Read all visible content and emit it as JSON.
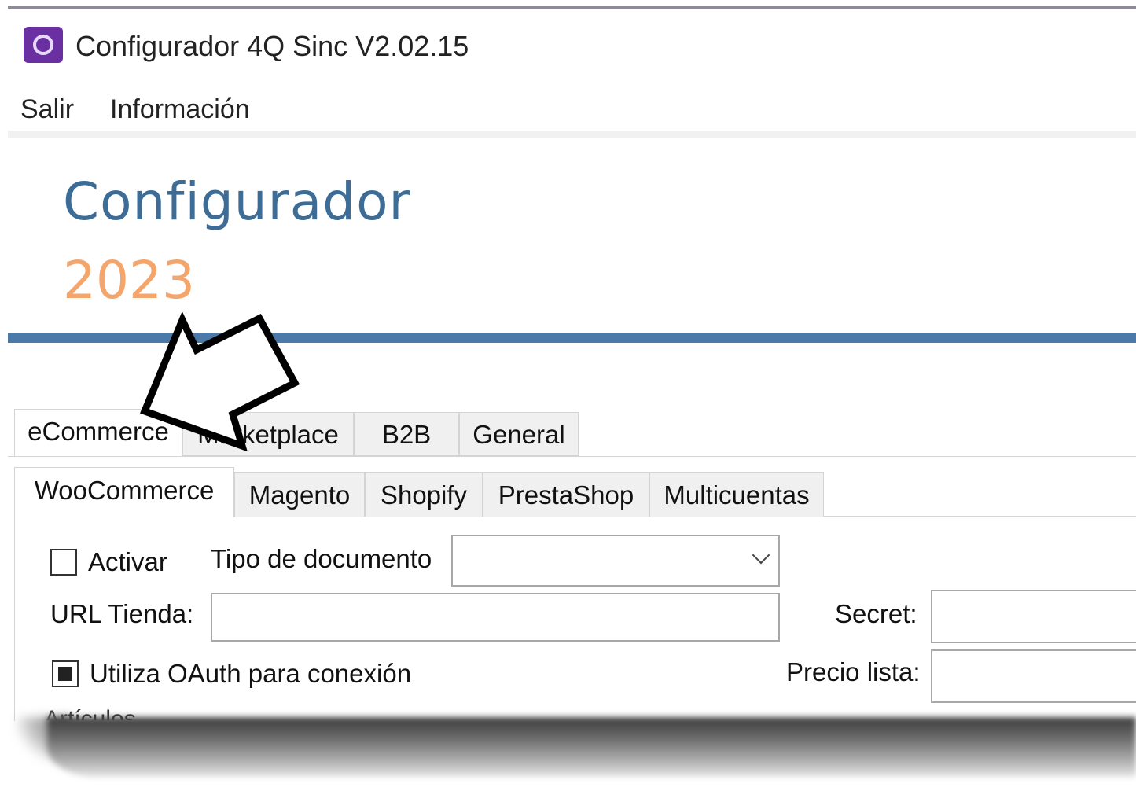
{
  "window": {
    "title": "Configurador 4Q Sinc V2.02.15",
    "icon": "app-4q-icon"
  },
  "menu": {
    "items": [
      "Salir",
      "Información"
    ]
  },
  "brand": {
    "title": "Configurador",
    "year": "2023",
    "colors": {
      "title": "#3d6d97",
      "year": "#f3a56b",
      "bar": "#4b7aa8"
    }
  },
  "tabs_outer": {
    "items": [
      "eCommerce",
      "Marketplace",
      "B2B",
      "General"
    ],
    "selected": "eCommerce"
  },
  "tabs_inner": {
    "items": [
      "WooCommerce",
      "Magento",
      "Shopify",
      "PrestaShop",
      "Multicuentas"
    ],
    "selected": "WooCommerce"
  },
  "form": {
    "activar": {
      "label": "Activar",
      "checked": false
    },
    "tipo_documento": {
      "label": "Tipo de documento",
      "value": ""
    },
    "url_tienda": {
      "label": "URL Tienda:",
      "value": ""
    },
    "oauth": {
      "label": "Utiliza OAuth  para conexión",
      "checked": true
    },
    "secret": {
      "label": "Secret:",
      "value": ""
    },
    "precio_lista": {
      "label": "Precio lista:",
      "value": ""
    },
    "articulos": {
      "label": "Artículos"
    }
  },
  "annotation": {
    "icon": "pointer-arrow-icon"
  }
}
